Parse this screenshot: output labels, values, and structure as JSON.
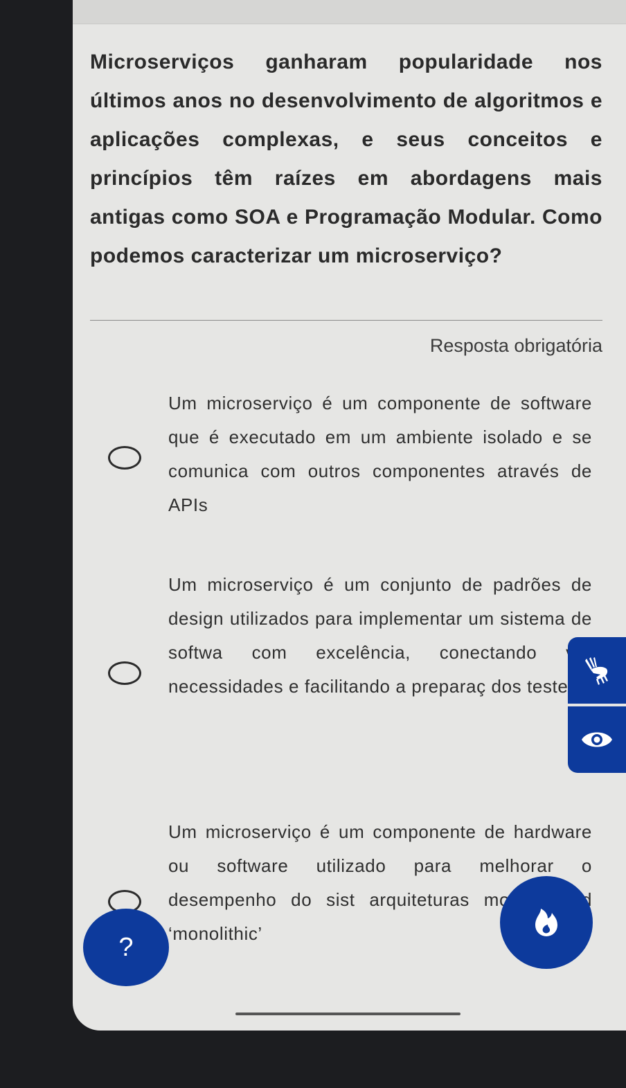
{
  "question": "Microserviços ganharam popularidade nos últimos anos no desenvolvimento de algoritmos e aplicações complexas, e seus conceitos e princípios têm raízes em abordagens mais antigas como SOA e Programação Modular. Como podemos caracterizar um microserviço?",
  "required_label": "Resposta obrigatória",
  "options": [
    {
      "text": "Um microserviço é um componente de software que é executado em um ambiente isolado e se comunica com outros componentes através de APIs",
      "selected": false
    },
    {
      "text": "Um microserviço é um conjunto de padrões de design utilizados para implementar um sistema de softwa com excelência, conectando vár necessidades e facilitando a preparaç dos testes",
      "selected": false
    },
    {
      "text": "Um microserviço é um componente de hardware ou software utilizado para melhorar o desempenho do sist arquiteturas modernas d ‘monolithic’",
      "selected": false
    }
  ],
  "widgets": {
    "sign_language": "sign-language-icon",
    "visibility": "eye-icon",
    "fire": "fire-icon",
    "help_label": "?"
  },
  "colors": {
    "accent": "#0d3a9c",
    "background": "#e6e6e4"
  }
}
